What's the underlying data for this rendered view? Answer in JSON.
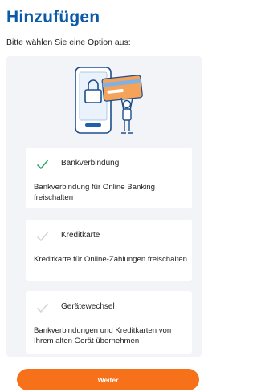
{
  "header": {
    "title": "Hinzufügen",
    "subtitle": "Bitte wählen Sie eine Option aus:"
  },
  "illustration": {
    "icon": "phone-lock-card-person-illustration"
  },
  "options": [
    {
      "title": "Bankverbindung",
      "description": "Bankverbindung für Online Banking freischalten",
      "selected": true
    },
    {
      "title": "Kreditkarte",
      "description": "Kreditkarte für Online-Zahlungen freischalten",
      "selected": false
    },
    {
      "title": "Gerätewechsel",
      "description": "Bankverbindungen und Kreditkarten von Ihrem alten Gerät übernehmen",
      "selected": false
    }
  ],
  "footer": {
    "continue_label": "Weiter"
  },
  "colors": {
    "title": "#0a5aa8",
    "accent": "#f7701a",
    "check_active": "#2fa86a",
    "check_inactive": "#d4d6dc",
    "panel": "#f3f4f8"
  }
}
